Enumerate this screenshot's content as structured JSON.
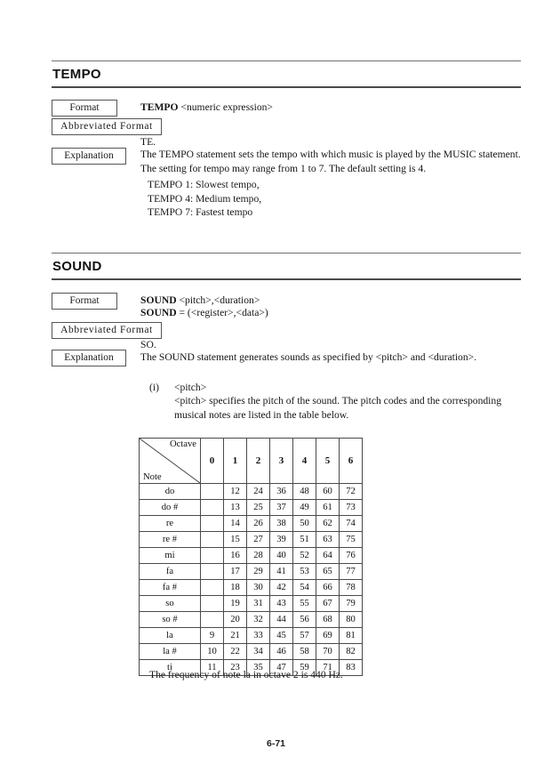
{
  "page": {
    "number": "6-71",
    "background_color": "#ffffff",
    "text_color": "#1a1a1a",
    "rule_color": "#4a4a4a"
  },
  "sections": [
    {
      "id": "tempo",
      "title": "TEMPO",
      "labels": {
        "format": "Format",
        "abbreviated_format": "Abbreviated Format",
        "explanation": "Explanation"
      },
      "format_lines": [
        {
          "keyword": "TEMPO",
          "rest": " <numeric expression>"
        }
      ],
      "abbreviation": "TE.",
      "explanation_paragraph": "The TEMPO statement sets the tempo with which music is played by the MUSIC statement. The setting for tempo may range from 1 to 7. The default setting is 4.",
      "list": [
        "TEMPO 1: Slowest tempo,",
        "TEMPO 4: Medium tempo,",
        "TEMPO 7: Fastest tempo"
      ]
    },
    {
      "id": "sound",
      "title": "SOUND",
      "labels": {
        "format": "Format",
        "abbreviated_format": "Abbreviated Format",
        "explanation": "Explanation"
      },
      "format_lines": [
        {
          "keyword": "SOUND",
          "rest": " <pitch>,<duration>"
        },
        {
          "keyword": "SOUND",
          "rest": " = (<register>,<data>)"
        }
      ],
      "abbreviation": "SO.",
      "explanation_paragraph": "The SOUND statement generates sounds as specified by <pitch> and <duration>.",
      "item_marker": "(i)",
      "item_title": "<pitch>",
      "item_paragraph": "<pitch> specifies the pitch of the sound. The pitch codes and the corresponding musical notes are listed in the table below."
    }
  ],
  "pitch_table": {
    "corner": {
      "octave_label": "Octave",
      "note_label": "Note"
    },
    "octave_headers": [
      "0",
      "1",
      "2",
      "3",
      "4",
      "5",
      "6"
    ],
    "rows": [
      {
        "note": "do",
        "values": [
          "",
          "12",
          "24",
          "36",
          "48",
          "60",
          "72"
        ]
      },
      {
        "note": "do #",
        "values": [
          "",
          "13",
          "25",
          "37",
          "49",
          "61",
          "73"
        ]
      },
      {
        "note": "re",
        "values": [
          "",
          "14",
          "26",
          "38",
          "50",
          "62",
          "74"
        ]
      },
      {
        "note": "re #",
        "values": [
          "",
          "15",
          "27",
          "39",
          "51",
          "63",
          "75"
        ]
      },
      {
        "note": "mi",
        "values": [
          "",
          "16",
          "28",
          "40",
          "52",
          "64",
          "76"
        ]
      },
      {
        "note": "fa",
        "values": [
          "",
          "17",
          "29",
          "41",
          "53",
          "65",
          "77"
        ]
      },
      {
        "note": "fa #",
        "values": [
          "",
          "18",
          "30",
          "42",
          "54",
          "66",
          "78"
        ]
      },
      {
        "note": "so",
        "values": [
          "",
          "19",
          "31",
          "43",
          "55",
          "67",
          "79"
        ]
      },
      {
        "note": "so #",
        "values": [
          "",
          "20",
          "32",
          "44",
          "56",
          "68",
          "80"
        ]
      },
      {
        "note": "la",
        "values": [
          "9",
          "21",
          "33",
          "45",
          "57",
          "69",
          "81"
        ]
      },
      {
        "note": "la #",
        "values": [
          "10",
          "22",
          "34",
          "46",
          "58",
          "70",
          "82"
        ]
      },
      {
        "note": "ti",
        "values": [
          "11",
          "23",
          "35",
          "47",
          "59",
          "71",
          "83"
        ]
      }
    ]
  },
  "footnote": "The frequency of note la in octave 2 is 440 Hz."
}
